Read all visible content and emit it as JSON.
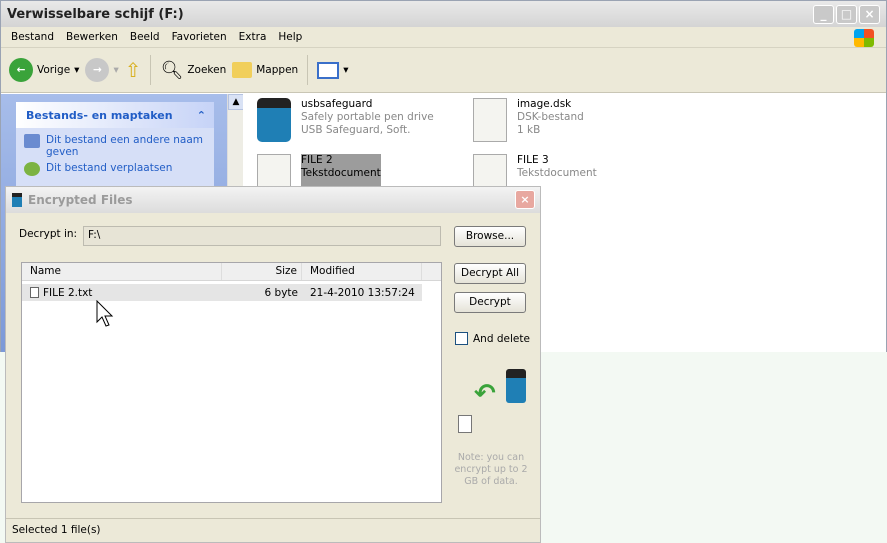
{
  "explorer": {
    "title": "Verwisselbare schijf (F:)",
    "menu": [
      "Bestand",
      "Bewerken",
      "Beeld",
      "Favorieten",
      "Extra",
      "Help"
    ],
    "toolbar": {
      "back": "Vorige",
      "search": "Zoeken",
      "folders": "Mappen"
    },
    "tasks": {
      "title": "Bestands- en maptaken",
      "items": [
        "Dit bestand een andere naam geven",
        "Dit bestand verplaatsen"
      ]
    },
    "files": [
      {
        "name": "usbsafeguard",
        "line1": "Safely portable pen drive",
        "line2": "USB Safeguard, Soft."
      },
      {
        "name": "image.dsk",
        "line1": "DSK-bestand",
        "line2": "1 kB"
      },
      {
        "name": "FILE 2",
        "line1": "Tekstdocument"
      },
      {
        "name": "FILE 3",
        "line1": "Tekstdocument"
      }
    ]
  },
  "dialog": {
    "title": "Encrypted Files",
    "decrypt_in_label": "Decrypt in:",
    "decrypt_in_value": "F:\\",
    "browse": "Browse...",
    "decrypt_all": "Decrypt All",
    "decrypt": "Decrypt",
    "and_delete": "And delete",
    "columns": {
      "name": "Name",
      "size": "Size",
      "modified": "Modified"
    },
    "rows": [
      {
        "name": "FILE 2.txt",
        "size": "6 byte",
        "modified": "21-4-2010 13:57:24"
      }
    ],
    "note": "Note: you can encrypt up to 2 GB of data.",
    "status": "Selected 1 file(s)"
  }
}
